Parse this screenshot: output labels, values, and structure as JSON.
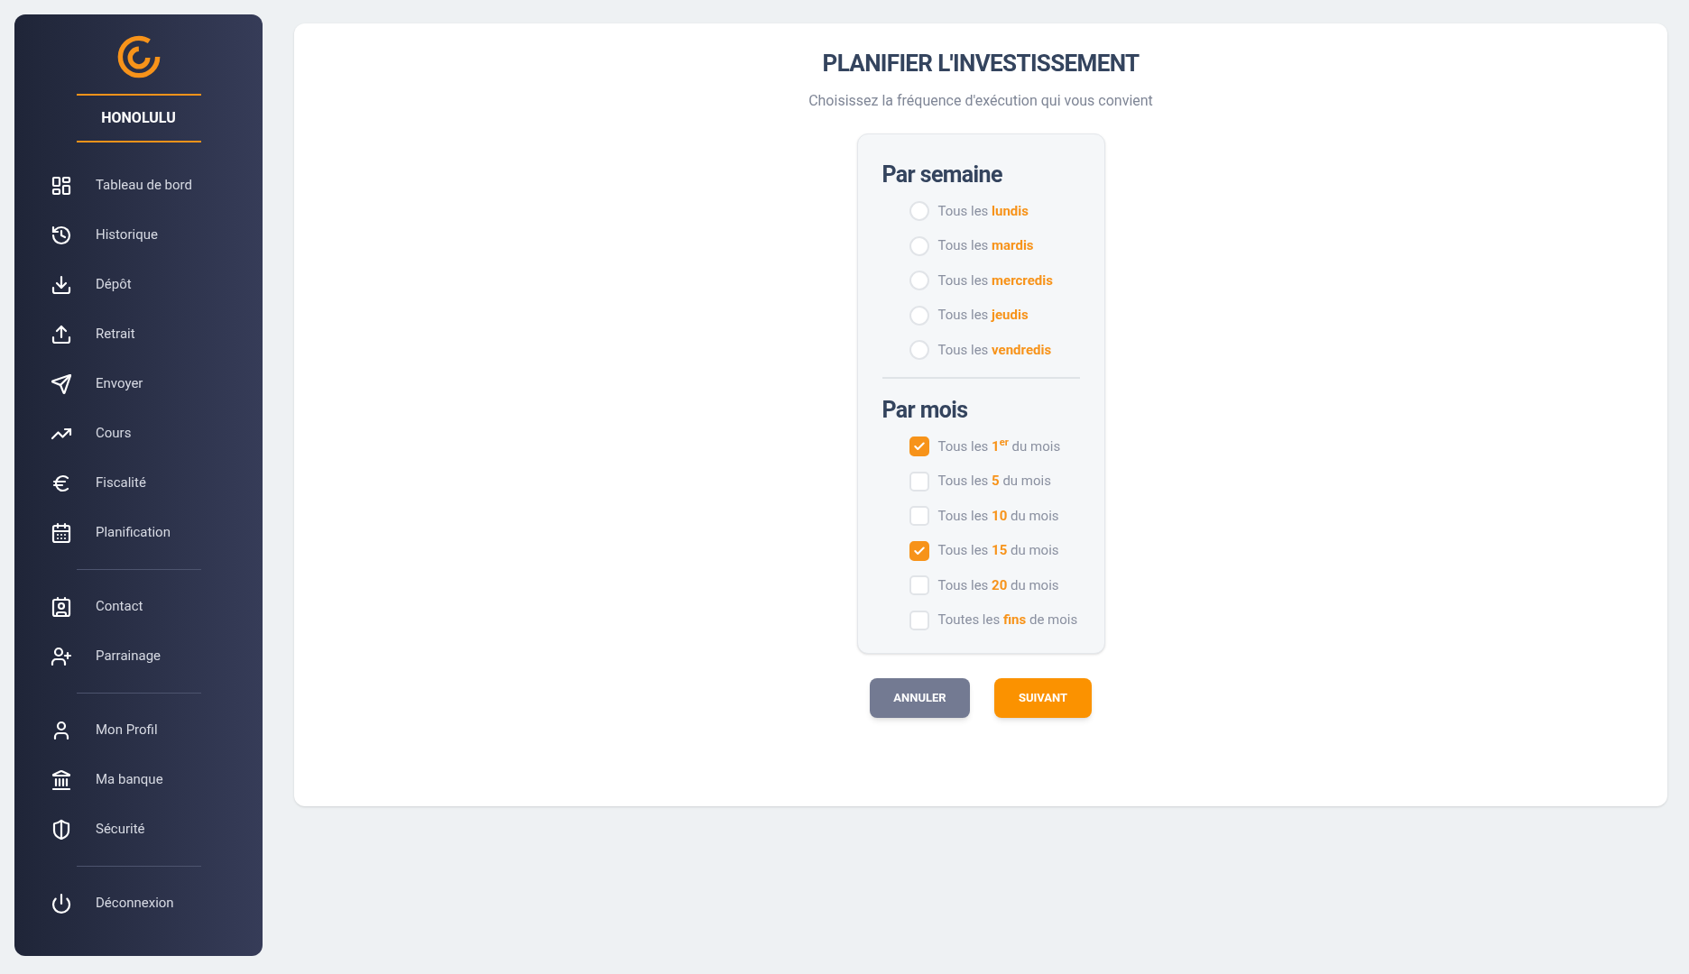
{
  "sidebar": {
    "brand": "HONOLULU",
    "groups": [
      [
        {
          "label": "Tableau de bord"
        },
        {
          "label": "Historique"
        },
        {
          "label": "Dépôt"
        },
        {
          "label": "Retrait"
        },
        {
          "label": "Envoyer"
        },
        {
          "label": "Cours"
        },
        {
          "label": "Fiscalité"
        },
        {
          "label": "Planification"
        }
      ],
      [
        {
          "label": "Contact"
        },
        {
          "label": "Parrainage"
        }
      ],
      [
        {
          "label": "Mon Profil"
        },
        {
          "label": "Ma banque"
        },
        {
          "label": "Sécurité"
        }
      ],
      [
        {
          "label": "Déconnexion"
        }
      ]
    ]
  },
  "main": {
    "title": "PLANIFIER L'INVESTISSEMENT",
    "subtitle": "Choisissez la fréquence d'exécution qui vous convient",
    "sections": [
      {
        "heading": "Par semaine",
        "kind": "radio",
        "options": [
          {
            "label": "Tous les **lundis**",
            "selected": false
          },
          {
            "label": "Tous les **mardis**",
            "selected": false
          },
          {
            "label": "Tous les **mercredis**",
            "selected": false
          },
          {
            "label": "Tous les **jeudis**",
            "selected": false
          },
          {
            "label": "Tous les **vendredis**",
            "selected": false
          }
        ]
      },
      {
        "heading": "Par mois",
        "kind": "checkbox",
        "options": [
          {
            "label": "Tous les **1**$^{er}$ du mois",
            "checked": true
          },
          {
            "label": "Tous les **5** du mois",
            "checked": false
          },
          {
            "label": "Tous les **10** du mois",
            "checked": false
          },
          {
            "label": "Tous les **15** du mois",
            "checked": true
          },
          {
            "label": "Tous les **20** du mois",
            "checked": false
          },
          {
            "label": "Toutes les **fins** de mois",
            "checked": false
          }
        ]
      }
    ],
    "buttons": [
      {
        "label": "ANNULER",
        "kind": "secondary"
      },
      {
        "label": "SUIVANT",
        "kind": "primary"
      }
    ]
  }
}
